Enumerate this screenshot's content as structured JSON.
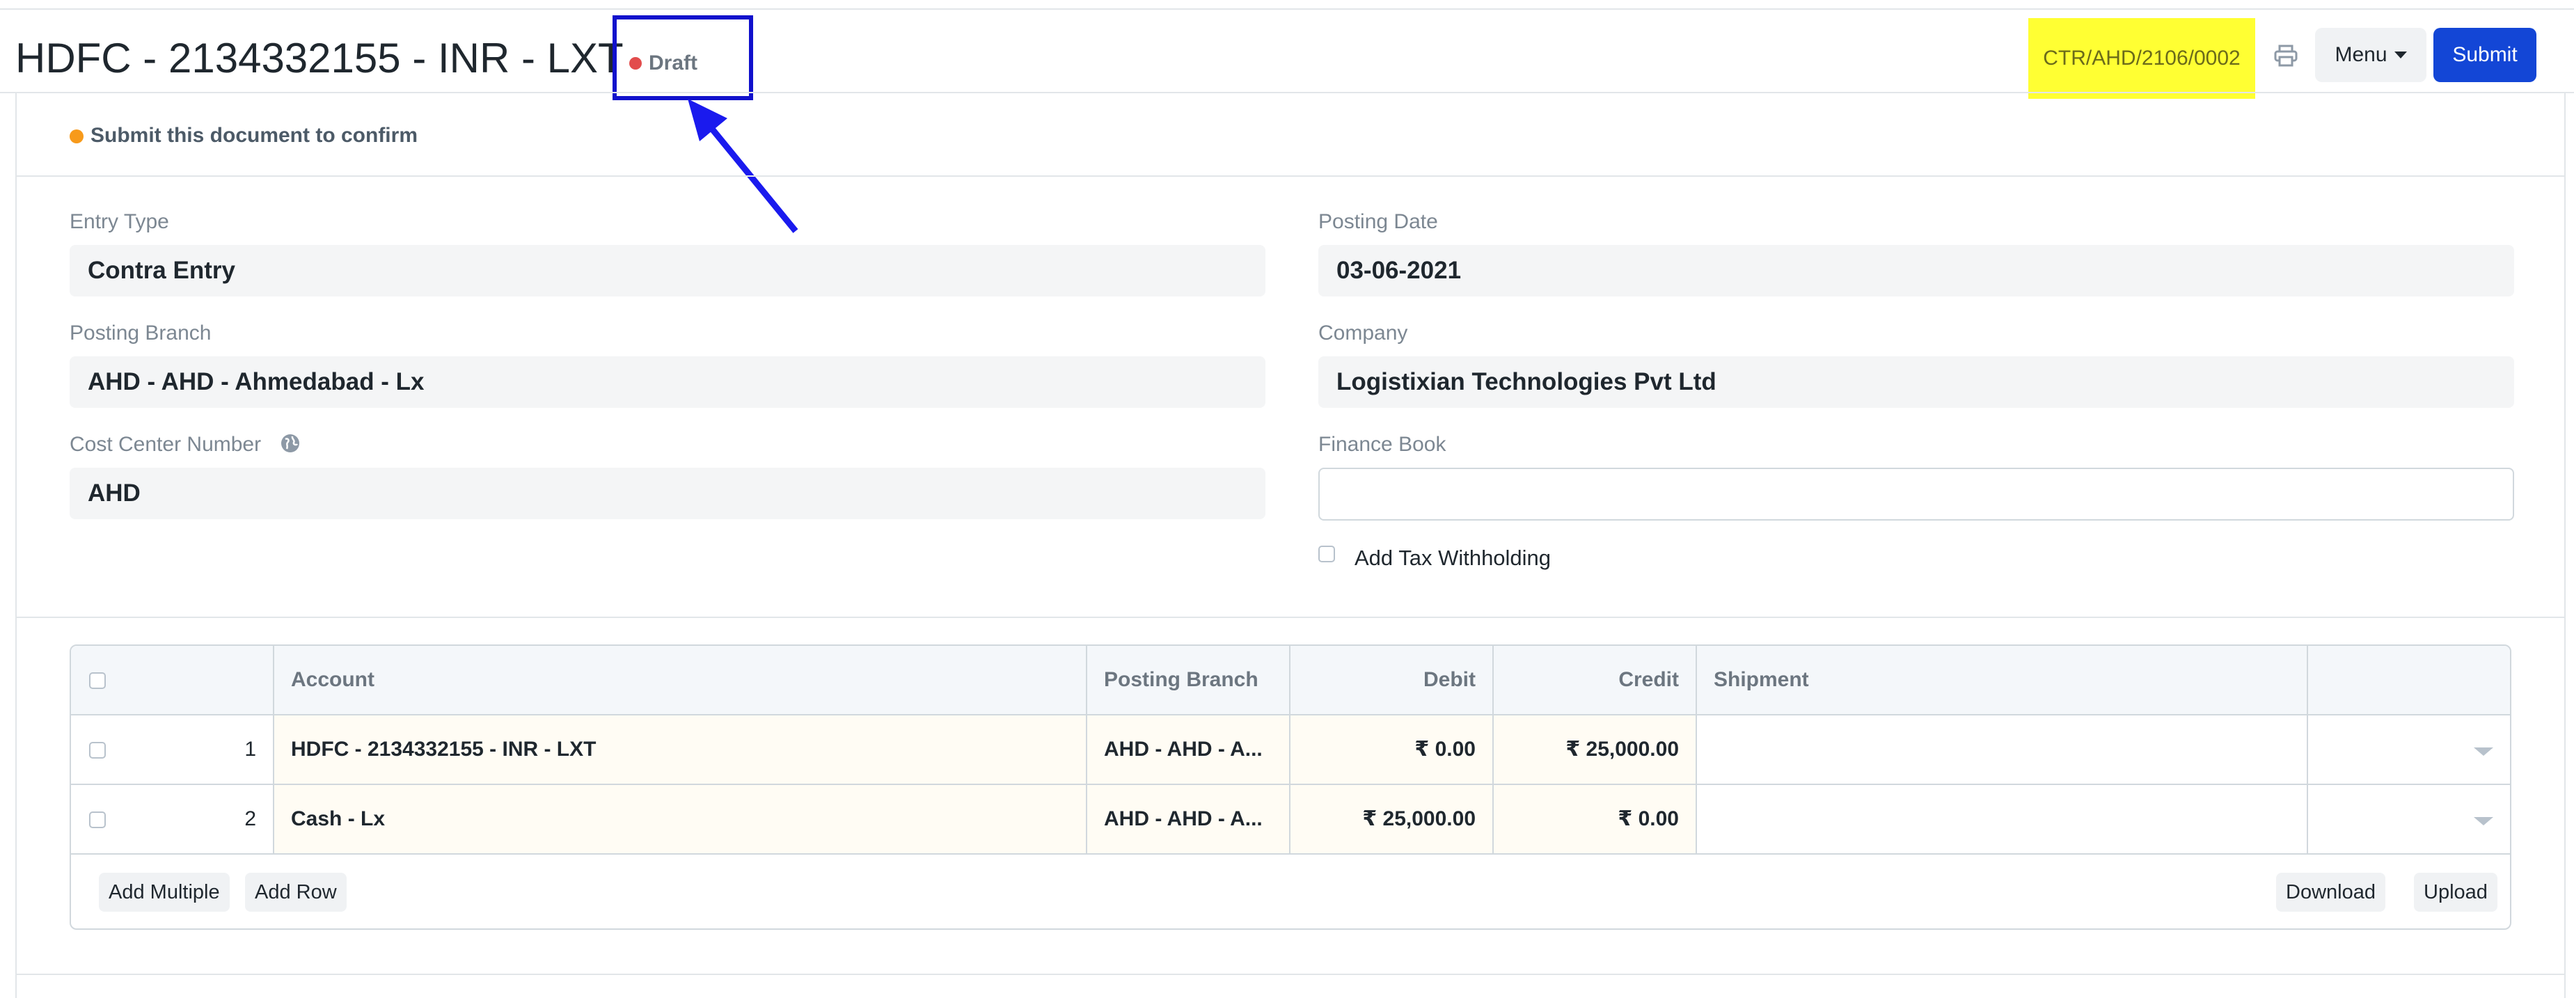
{
  "header": {
    "title": "HDFC - 2134332155 - INR - LXT",
    "status": "Draft",
    "doc_name": "CTR/AHD/2106/0002",
    "menu_label": "Menu",
    "submit_label": "Submit"
  },
  "alert": {
    "text": "Submit this document to confirm"
  },
  "fields": {
    "entry_type": {
      "label": "Entry Type",
      "value": "Contra Entry"
    },
    "posting_branch": {
      "label": "Posting Branch",
      "value": "AHD - AHD - Ahmedabad - Lx"
    },
    "cost_center": {
      "label": "Cost Center Number",
      "value": "AHD"
    },
    "posting_date": {
      "label": "Posting Date",
      "value": "03-06-2021"
    },
    "company": {
      "label": "Company",
      "value": "Logistixian Technologies Pvt Ltd"
    },
    "finance_book": {
      "label": "Finance Book",
      "value": ""
    },
    "add_tax_withholding": {
      "label": "Add Tax Withholding",
      "checked": false
    }
  },
  "table": {
    "columns": [
      "Account",
      "Posting Branch",
      "Debit",
      "Credit",
      "Shipment"
    ],
    "rows": [
      {
        "idx": "1",
        "account": "HDFC - 2134332155 - INR - LXT",
        "posting_branch": "AHD - AHD - A...",
        "debit": "₹ 0.00",
        "credit": "₹ 25,000.00",
        "shipment": ""
      },
      {
        "idx": "2",
        "account": "Cash - Lx",
        "posting_branch": "AHD - AHD - A...",
        "debit": "₹ 25,000.00",
        "credit": "₹ 0.00",
        "shipment": ""
      }
    ],
    "buttons": {
      "add_multiple": "Add Multiple",
      "add_row": "Add Row",
      "download": "Download",
      "upload": "Upload"
    }
  },
  "colors": {
    "primary": "#1346d6",
    "draft_indicator": "#e24c4c",
    "alert_indicator": "#f79a1b",
    "highlight": "#ffff33",
    "annotation": "#1111cc"
  },
  "icons": {
    "print": "printer-icon",
    "cost_center_info": "globe-icon",
    "menu_caret": "caret-down-icon"
  }
}
